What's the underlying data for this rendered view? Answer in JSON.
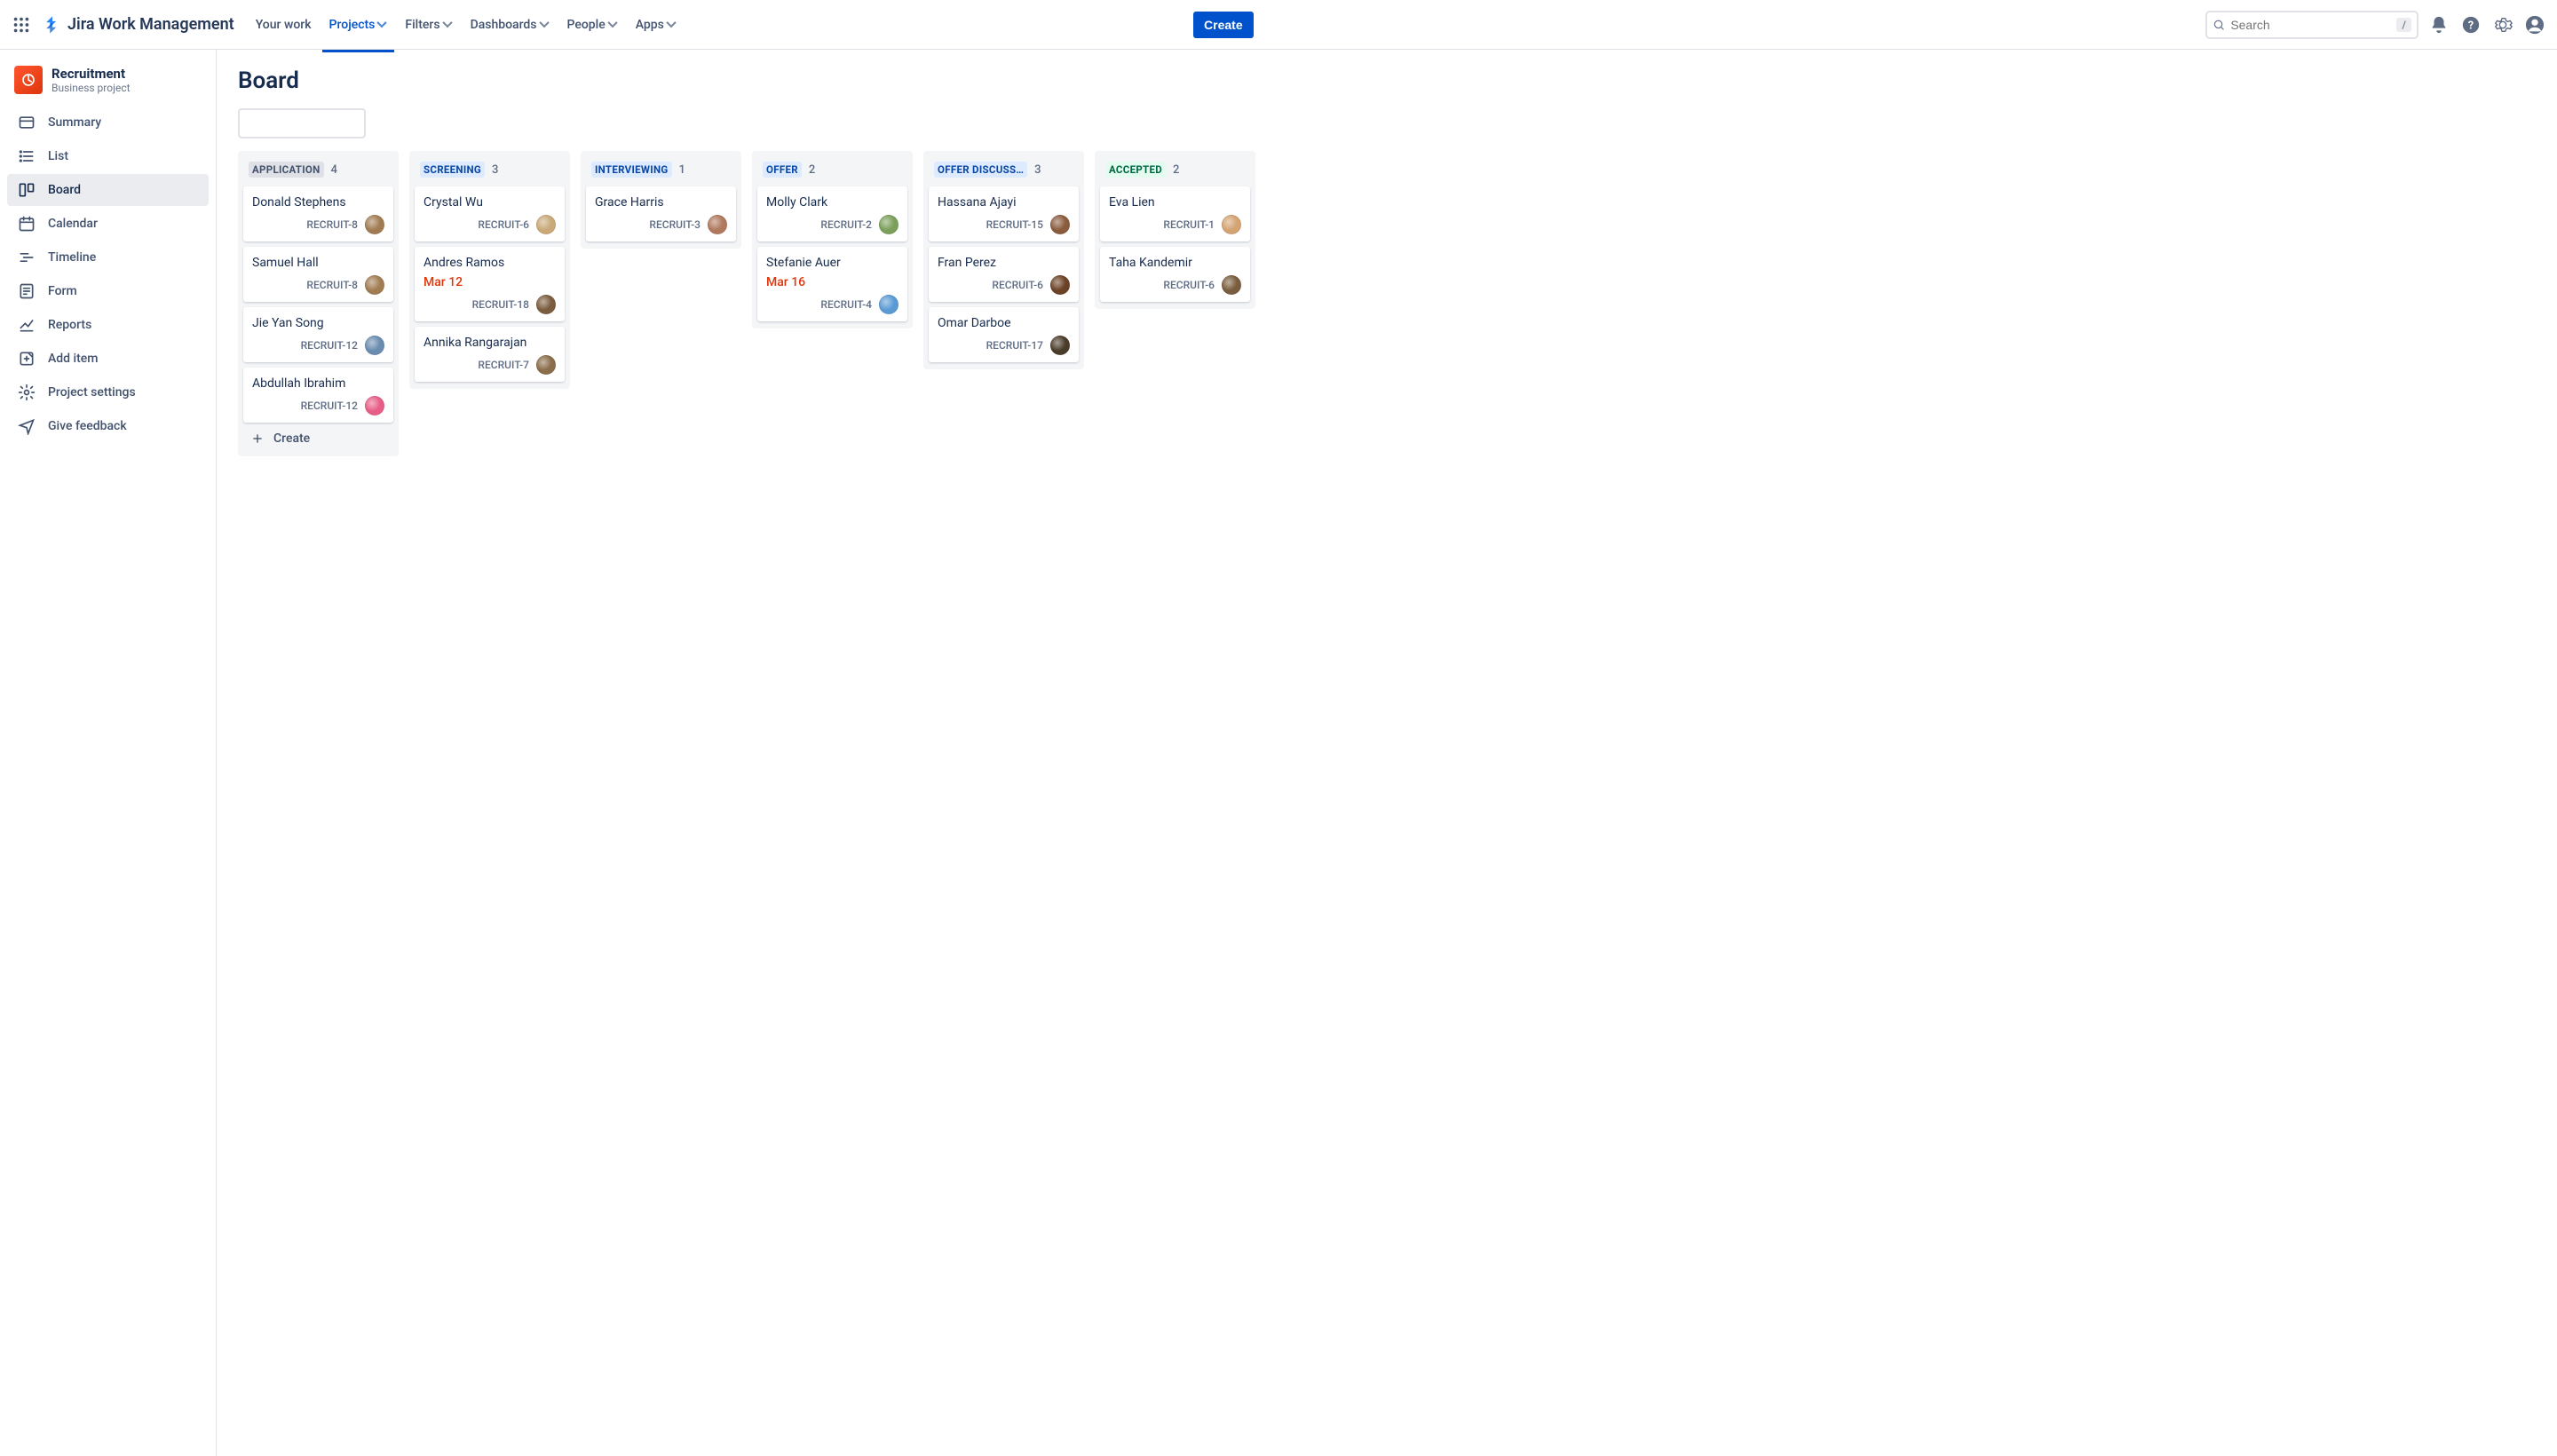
{
  "app": {
    "name": "Jira Work Management"
  },
  "nav": {
    "items": [
      {
        "label": "Your work",
        "dropdown": false
      },
      {
        "label": "Projects",
        "dropdown": true,
        "active": true
      },
      {
        "label": "Filters",
        "dropdown": true
      },
      {
        "label": "Dashboards",
        "dropdown": true
      },
      {
        "label": "People",
        "dropdown": true
      },
      {
        "label": "Apps",
        "dropdown": true
      }
    ],
    "create_label": "Create",
    "search_placeholder": "Search",
    "search_shortcut": "/"
  },
  "project": {
    "name": "Recruitment",
    "type": "Business project"
  },
  "sidebar": {
    "items": [
      {
        "label": "Summary",
        "icon": "card-icon"
      },
      {
        "label": "List",
        "icon": "list-icon"
      },
      {
        "label": "Board",
        "icon": "board-icon",
        "active": true
      },
      {
        "label": "Calendar",
        "icon": "calendar-icon"
      },
      {
        "label": "Timeline",
        "icon": "timeline-icon"
      },
      {
        "label": "Form",
        "icon": "form-icon"
      },
      {
        "label": "Reports",
        "icon": "reports-icon"
      },
      {
        "label": "Add item",
        "icon": "add-item-icon"
      },
      {
        "label": "Project settings",
        "icon": "settings-icon"
      },
      {
        "label": "Give feedback",
        "icon": "feedback-icon"
      }
    ]
  },
  "board": {
    "title": "Board",
    "create_label": "Create",
    "columns": [
      {
        "name": "APPLICATION",
        "count": 4,
        "style": "gray",
        "show_create": true,
        "cards": [
          {
            "name": "Donald Stephens",
            "key": "RECRUIT-8",
            "avatar": "#a17c52"
          },
          {
            "name": "Samuel Hall",
            "key": "RECRUIT-8",
            "avatar": "#a17c52"
          },
          {
            "name": "Jie Yan Song",
            "key": "RECRUIT-12",
            "avatar": "#6a8caf"
          },
          {
            "name": "Abdullah Ibrahim",
            "key": "RECRUIT-12",
            "avatar": "#e85d88"
          }
        ]
      },
      {
        "name": "SCREENING",
        "count": 3,
        "style": "blue",
        "cards": [
          {
            "name": "Crystal Wu",
            "key": "RECRUIT-6",
            "avatar": "#c9a978"
          },
          {
            "name": "Andres Ramos",
            "key": "RECRUIT-18",
            "date": "Mar 12",
            "avatar": "#7a5c3e"
          },
          {
            "name": "Annika Rangarajan",
            "key": "RECRUIT-7",
            "avatar": "#8a6d4a"
          }
        ]
      },
      {
        "name": "INTERVIEWING",
        "count": 1,
        "style": "blue",
        "cards": [
          {
            "name": "Grace Harris",
            "key": "RECRUIT-3",
            "avatar": "#b0785c"
          }
        ]
      },
      {
        "name": "OFFER",
        "count": 2,
        "style": "blue",
        "cards": [
          {
            "name": "Molly Clark",
            "key": "RECRUIT-2",
            "avatar": "#7ba05b"
          },
          {
            "name": "Stefanie Auer",
            "key": "RECRUIT-4",
            "date": "Mar 16",
            "avatar": "#5b9bd5"
          }
        ]
      },
      {
        "name": "OFFER DISCUSS…",
        "count": 3,
        "style": "blue",
        "cards": [
          {
            "name": "Hassana Ajayi",
            "key": "RECRUIT-15",
            "avatar": "#8a5c3e"
          },
          {
            "name": "Fran Perez",
            "key": "RECRUIT-6",
            "avatar": "#6b4226"
          },
          {
            "name": "Omar Darboe",
            "key": "RECRUIT-17",
            "avatar": "#4a3c2a"
          }
        ]
      },
      {
        "name": "ACCEPTED",
        "count": 2,
        "style": "green",
        "cards": [
          {
            "name": "Eva Lien",
            "key": "RECRUIT-1",
            "avatar": "#d4a373"
          },
          {
            "name": "Taha Kandemir",
            "key": "RECRUIT-6",
            "avatar": "#7a5c3e"
          }
        ]
      }
    ]
  }
}
